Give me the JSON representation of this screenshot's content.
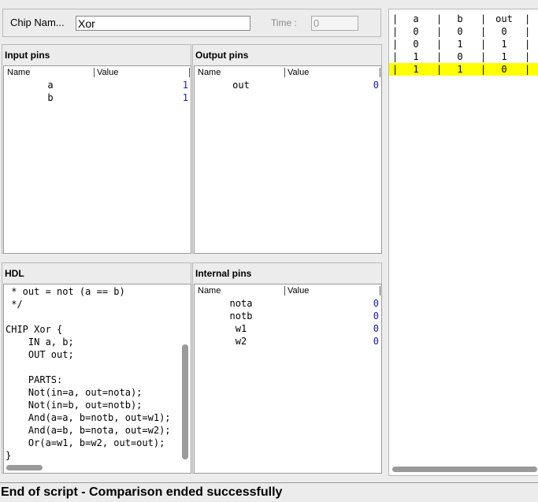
{
  "chip": {
    "name_label": "Chip Nam...",
    "name_value": "Xor",
    "time_label": "Time :",
    "time_value": "0"
  },
  "input_pins": {
    "title": "Input pins",
    "col_name": "Name",
    "col_value": "Value",
    "rows": [
      {
        "name": "a",
        "value": "1"
      },
      {
        "name": "b",
        "value": "1"
      }
    ]
  },
  "output_pins": {
    "title": "Output pins",
    "col_name": "Name",
    "col_value": "Value",
    "rows": [
      {
        "name": "out",
        "value": "0"
      }
    ]
  },
  "hdl": {
    "title": "HDL",
    "lines": [
      " * out = not (a == b)",
      " */",
      "",
      "CHIP Xor {",
      "    IN a, b;",
      "    OUT out;",
      "",
      "    PARTS:",
      "    Not(in=a, out=nota);",
      "    Not(in=b, out=notb);",
      "    And(a=a, b=notb, out=w1);",
      "    And(a=b, b=nota, out=w2);",
      "    Or(a=w1, b=w2, out=out);",
      "}"
    ]
  },
  "internal_pins": {
    "title": "Internal pins",
    "col_name": "Name",
    "col_value": "Value",
    "rows": [
      {
        "name": "nota",
        "value": "0"
      },
      {
        "name": "notb",
        "value": "0"
      },
      {
        "name": "w1",
        "value": "0"
      },
      {
        "name": "w2",
        "value": "0"
      }
    ]
  },
  "truth_table": {
    "headers": [
      "a",
      "b",
      "out"
    ],
    "rows": [
      [
        "0",
        "0",
        "0"
      ],
      [
        "0",
        "1",
        "1"
      ],
      [
        "1",
        "0",
        "1"
      ],
      [
        "1",
        "1",
        "0"
      ]
    ],
    "highlight_row": 3,
    "highlight_color": "#ffff00"
  },
  "status": {
    "message": "End of script - Comparison ended successfully"
  },
  "colors": {
    "value_blue": "#1a1aa8",
    "highlight": "#ffff00"
  }
}
